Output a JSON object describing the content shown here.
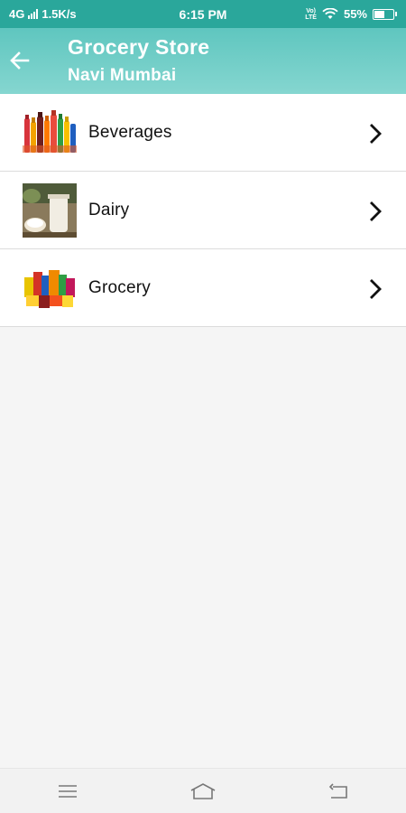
{
  "status_bar": {
    "network": "4G",
    "speed": "1.5K/s",
    "time": "6:15 PM",
    "volte_top": "Vo)",
    "volte_bottom": "LTE",
    "battery": "55%",
    "battery_level": 0.55
  },
  "app_bar": {
    "back_icon": "arrow-left-icon",
    "title": "Grocery Store",
    "subtitle": "Navi Mumbai",
    "accent_color": "#5fc6bf"
  },
  "categories": [
    {
      "label": "Beverages",
      "thumb": "beverages-thumbnail",
      "chevron": "chevron-right-icon"
    },
    {
      "label": "Dairy",
      "thumb": "dairy-thumbnail",
      "chevron": "chevron-right-icon"
    },
    {
      "label": "Grocery",
      "thumb": "grocery-thumbnail",
      "chevron": "chevron-right-icon"
    }
  ],
  "nav_bar": {
    "menu_icon": "menu-icon",
    "home_icon": "home-icon",
    "back_icon": "back-icon"
  }
}
